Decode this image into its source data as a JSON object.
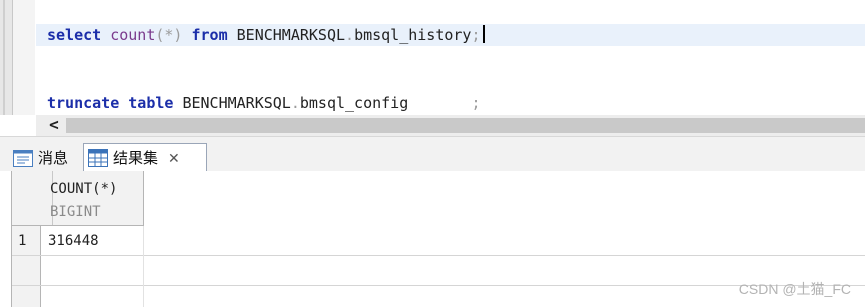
{
  "editor": {
    "line1": {
      "kw_select": "select",
      "fn_count": "count",
      "args": "(*)",
      "kw_from": "from",
      "schema": "BENCHMARKSQL",
      "dot": ".",
      "table": "bmsql_history",
      "semicolon": ";"
    },
    "line2": {
      "kw_truncate": "truncate",
      "kw_table": "table",
      "schema": "BENCHMARKSQL",
      "dot": ".",
      "table": "bmsql_config",
      "semicolon": ";"
    }
  },
  "scrollbar": {
    "left_arrow": "<"
  },
  "tabs": {
    "messages": "消息",
    "results": "结果集",
    "close": "✕"
  },
  "grid": {
    "columns": [
      {
        "name": "COUNT(*)",
        "type": "BIGINT"
      }
    ],
    "rows": [
      {
        "num": "1",
        "cells": [
          "316448"
        ]
      }
    ]
  },
  "watermark": "CSDN @土猫_FC",
  "colors": {
    "keyword": "#1b2ea9",
    "function": "#7a3a8c",
    "current_line": "#e9f1fb"
  }
}
